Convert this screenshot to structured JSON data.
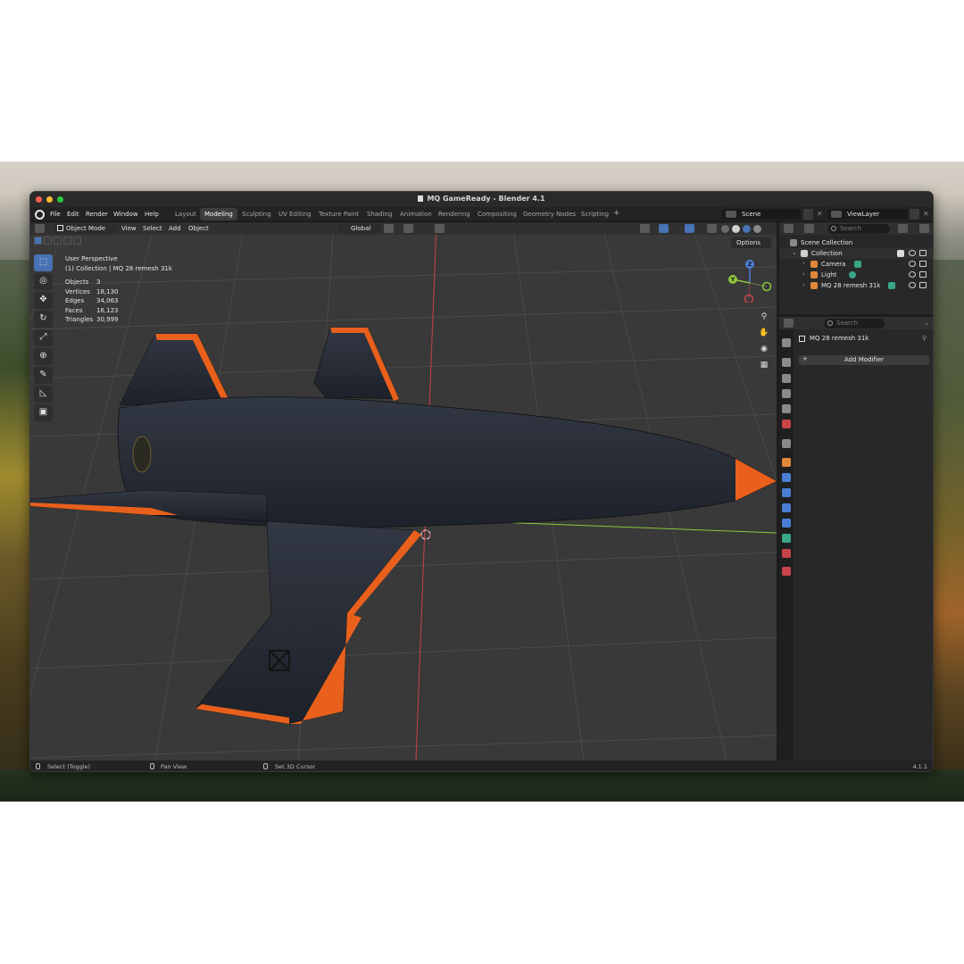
{
  "window": {
    "title": "MQ GameReady - Blender 4.1"
  },
  "menu": {
    "file": "File",
    "edit": "Edit",
    "render": "Render",
    "window": "Window",
    "help": "Help"
  },
  "workspaces": [
    {
      "label": "Layout"
    },
    {
      "label": "Modeling"
    },
    {
      "label": "Sculpting"
    },
    {
      "label": "UV Editing"
    },
    {
      "label": "Texture Paint"
    },
    {
      "label": "Shading"
    },
    {
      "label": "Animation"
    },
    {
      "label": "Rendering"
    },
    {
      "label": "Compositing"
    },
    {
      "label": "Geometry Nodes"
    },
    {
      "label": "Scripting"
    }
  ],
  "active_workspace": "Modeling",
  "scene": {
    "name": "Scene",
    "view_layer": "ViewLayer"
  },
  "viewport": {
    "mode": "Object Mode",
    "menus": {
      "view": "View",
      "select": "Select",
      "add": "Add",
      "object": "Object"
    },
    "transform_orientation": "Global",
    "options_label": "Options",
    "perspective": "User Perspective",
    "collection_info": "(1) Collection | MQ 28 remesh 31k",
    "stats": [
      {
        "label": "Objects",
        "value": "3"
      },
      {
        "label": "Vertices",
        "value": "18,130"
      },
      {
        "label": "Edges",
        "value": "34,063"
      },
      {
        "label": "Faces",
        "value": "16,123"
      },
      {
        "label": "Triangles",
        "value": "30,999"
      }
    ],
    "gizmo": {
      "z": "Z",
      "y": "Y"
    }
  },
  "outliner": {
    "search_placeholder": "Search",
    "scene_collection": "Scene Collection",
    "collection": "Collection",
    "items": [
      {
        "label": "Camera"
      },
      {
        "label": "Light"
      },
      {
        "label": "MQ 28 remesh 31k"
      }
    ]
  },
  "properties": {
    "search_placeholder": "Search",
    "object_name": "MQ 28 remesh 31k",
    "add_modifier": "Add Modifier"
  },
  "statusbar": {
    "select": "Select (Toggle)",
    "pan": "Pan View",
    "cursor": "Set 3D Cursor",
    "version": "4.1.1"
  },
  "colors": {
    "accent": "#4772b3",
    "aircraft_body": "#2a2f38",
    "aircraft_trim": "#e8601c",
    "viewport_bg": "#393939",
    "axis_x": "#c8434a",
    "axis_y": "#8cc63e",
    "axis_z": "#4a7ed6"
  }
}
